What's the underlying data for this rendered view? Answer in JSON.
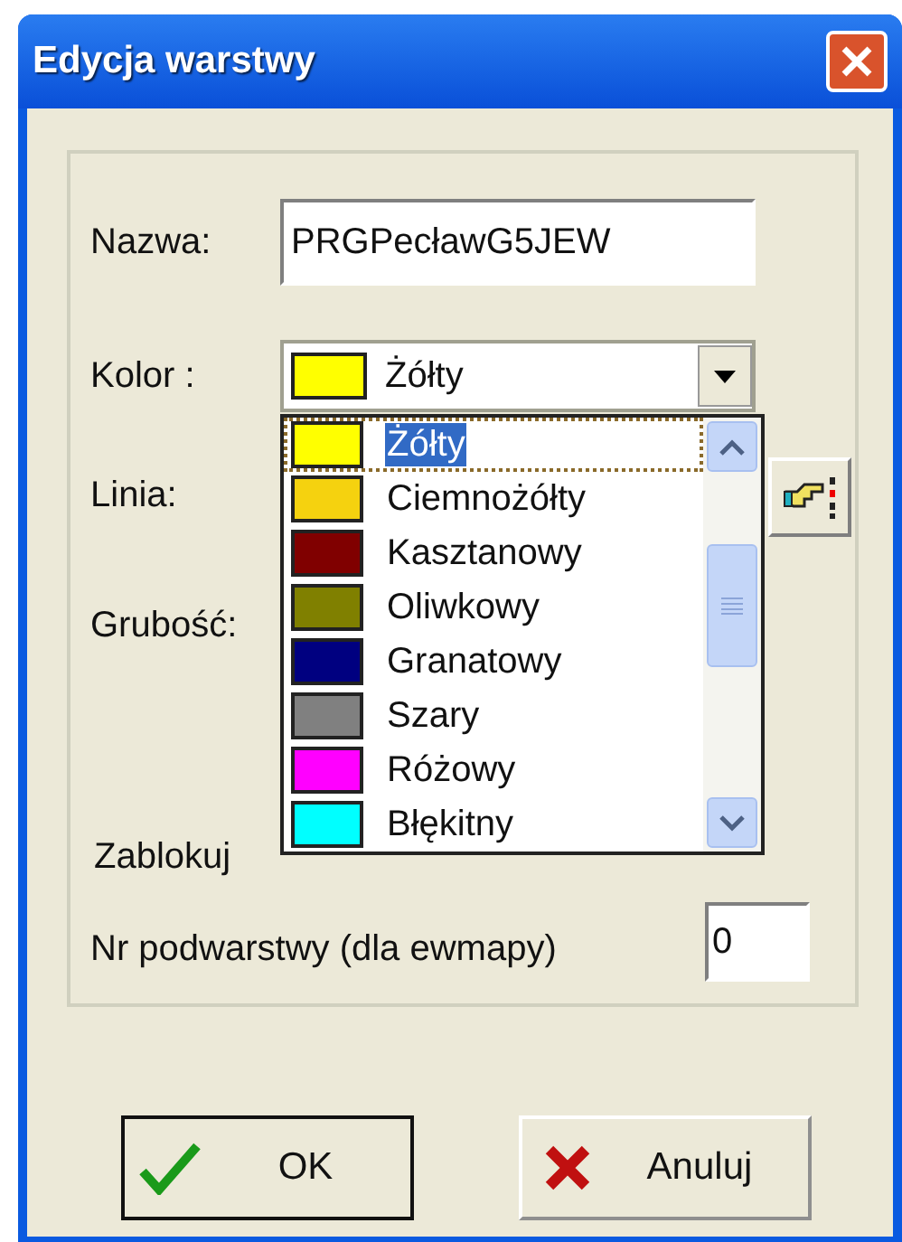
{
  "window": {
    "title": "Edycja warstwy"
  },
  "form": {
    "name_label": "Nazwa:",
    "name_value": "PRGPecławG5JEW",
    "color_label": "Kolor :",
    "color_value": "Żółty",
    "color": "#ffff00",
    "line_label": "Linia:",
    "thickness_label": "Grubość:",
    "lock_label": "Zablokuj",
    "sublayer_label": "Nr podwarstwy (dla ewmapy)",
    "sublayer_value": "0"
  },
  "color_list": [
    {
      "label": "Żółty",
      "color": "#ffff00",
      "selected": true
    },
    {
      "label": "Ciemnożółty",
      "color": "#f5d20f",
      "selected": false
    },
    {
      "label": "Kasztanowy",
      "color": "#800000",
      "selected": false
    },
    {
      "label": "Oliwkowy",
      "color": "#808000",
      "selected": false
    },
    {
      "label": "Granatowy",
      "color": "#000080",
      "selected": false
    },
    {
      "label": "Szary",
      "color": "#808080",
      "selected": false
    },
    {
      "label": "Różowy",
      "color": "#ff00ff",
      "selected": false
    },
    {
      "label": "Błękitny",
      "color": "#00ffff",
      "selected": false
    }
  ],
  "buttons": [
    {
      "kind": "ok",
      "label": "OK"
    },
    {
      "kind": "cancel",
      "label": "Anuluj"
    }
  ]
}
